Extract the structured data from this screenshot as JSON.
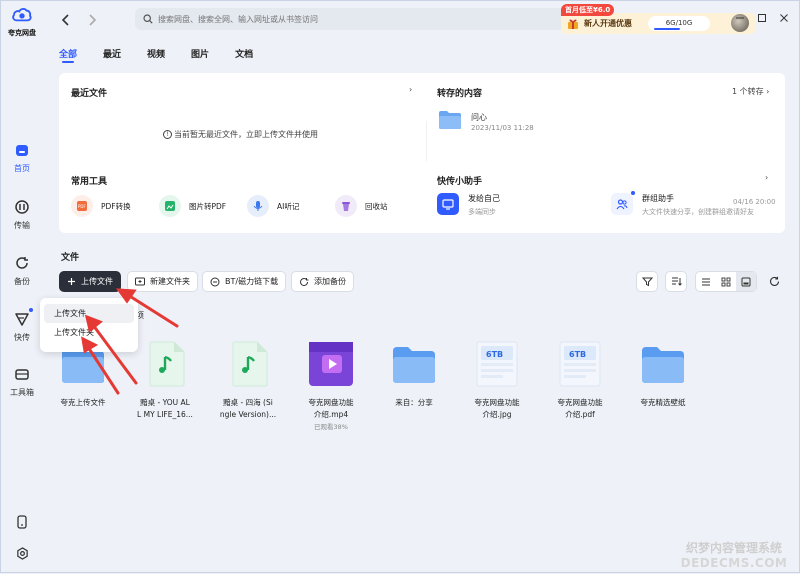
{
  "app": {
    "name": "夸克网盘"
  },
  "colors": {
    "accent": "#2f5bff",
    "promo_red": "#f2483e",
    "arrow_red": "#e53935"
  },
  "sidebar": {
    "items": [
      {
        "label": "首页",
        "icon": "home-icon",
        "active": true
      },
      {
        "label": "传输",
        "icon": "transfer-icon"
      },
      {
        "label": "备份",
        "icon": "backup-icon"
      },
      {
        "label": "快传",
        "icon": "quick-send-icon",
        "dot": true
      },
      {
        "label": "工具箱",
        "icon": "toolbox-icon"
      }
    ]
  },
  "search": {
    "placeholder": "搜索网盘、搜索全网、输入网址或从书签访问"
  },
  "promo": {
    "tag": "首月低至¥6.0",
    "label": "新人开通优惠",
    "storage": "6G/10G"
  },
  "tabs": [
    "全部",
    "最近",
    "视频",
    "图片",
    "文档"
  ],
  "recent": {
    "title": "最近文件",
    "empty": "当前暂无最近文件，立即上传文件并使用"
  },
  "saved": {
    "title": "转存的内容",
    "count": "1 个转存",
    "item_name": "问心",
    "item_date": "2023/11/03 11:28"
  },
  "tools": {
    "title": "常用工具",
    "items": [
      {
        "label": "PDF转换",
        "icon": "pdf-convert-icon"
      },
      {
        "label": "图片转PDF",
        "icon": "image-to-pdf-icon"
      },
      {
        "label": "AI听记",
        "icon": "ai-transcribe-icon"
      },
      {
        "label": "回收站",
        "icon": "recycle-bin-icon"
      }
    ]
  },
  "assistant": {
    "title": "快传小助手",
    "items": [
      {
        "title": "发给自己",
        "sub": "多端同步",
        "icon": "send-self-icon"
      },
      {
        "title": "群组助手",
        "sub": "大文件快速分享，创建群组邀请好友",
        "date": "04/16 20:00",
        "icon": "group-assistant-icon"
      }
    ]
  },
  "files_section": {
    "title": "文件",
    "upload_label": "上传文件",
    "new_folder_label": "新建文件夹",
    "bt_label": "BT/磁力链下载",
    "add_backup_label": "添加备份",
    "dropdown": [
      "上传文件",
      "上传文件夹"
    ],
    "partial_header": "项"
  },
  "files": [
    {
      "name": "夸克上传文件",
      "type": "folder"
    },
    {
      "name": "黯桌 - YOU ALL MY LIFE_16...",
      "line1": "黯桌 - YOU AL",
      "line2": "L MY LIFE_16...",
      "type": "music"
    },
    {
      "name": "黯桌 - 四海 (Single Version)...",
      "line1": "黯桌 - 四海 (Si",
      "line2": "ngle Version)...",
      "type": "music"
    },
    {
      "name": "夸克网盘功能介绍.mp4",
      "line1": "夸克网盘功能",
      "line2": "介绍.mp4",
      "sub": "已观看38%",
      "type": "video"
    },
    {
      "name": "来自：分享",
      "type": "folder"
    },
    {
      "name": "夸克网盘功能介绍.jpg",
      "line1": "夸克网盘功能",
      "line2": "介绍.jpg",
      "type": "image"
    },
    {
      "name": "夸克网盘功能介绍.pdf",
      "line1": "夸克网盘功能",
      "line2": "介绍.pdf",
      "type": "pdf"
    },
    {
      "name": "夸克精选壁纸",
      "type": "folder"
    }
  ],
  "watermark": {
    "line1": "织梦内容管理系统",
    "line2": "DEDECMS.COM"
  }
}
